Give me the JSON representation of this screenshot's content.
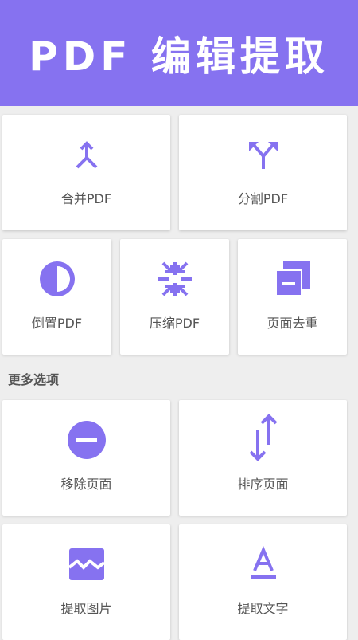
{
  "header": {
    "title": "PDF 编辑提取"
  },
  "accent_color": "#8672f0",
  "tools": {
    "merge": {
      "label": "合并PDF",
      "icon": "merge-icon"
    },
    "split": {
      "label": "分割PDF",
      "icon": "split-icon"
    },
    "reverse": {
      "label": "倒置PDF",
      "icon": "contrast-icon"
    },
    "compress": {
      "label": "压缩PDF",
      "icon": "compress-icon"
    },
    "dedupe": {
      "label": "页面去重",
      "icon": "copy-pages-icon"
    }
  },
  "more": {
    "title": "更多选项",
    "remove": {
      "label": "移除页面",
      "icon": "remove-circle-icon"
    },
    "sort": {
      "label": "排序页面",
      "icon": "swap-vertical-icon"
    },
    "extract_images": {
      "label": "提取图片",
      "icon": "image-icon"
    },
    "extract_text": {
      "label": "提取文字",
      "icon": "text-format-icon"
    }
  }
}
